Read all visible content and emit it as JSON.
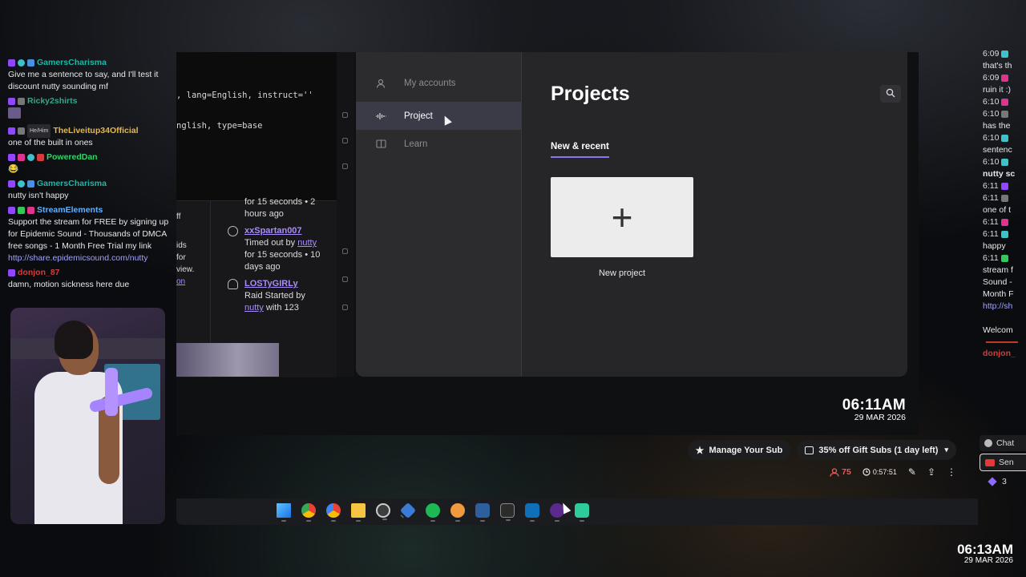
{
  "left_chat": [
    {
      "user": "GamersCharisma",
      "color": "#1fb6a6",
      "badges": [
        "purple",
        "teal",
        "blue"
      ],
      "pronoun": "",
      "text": "Give me a sentence to say, and I'll test it discount nutty sounding mf"
    },
    {
      "user": "Ricky2shirts",
      "color": "#3aa38a",
      "badges": [
        "purple",
        "gray"
      ],
      "pronoun": "",
      "text": "",
      "emote": true
    },
    {
      "user": "TheLiveitup34Official",
      "color": "#e6b84a",
      "badges": [
        "purple",
        "gray"
      ],
      "pronoun": "He/Him",
      "text": "one of the built in ones"
    },
    {
      "user": "PoweredDan",
      "color": "#2fd66b",
      "badges": [
        "purple",
        "pink",
        "teal",
        "red"
      ],
      "pronoun": "",
      "text": "😂"
    },
    {
      "user": "GamersCharisma",
      "color": "#1fb6a6",
      "badges": [
        "purple",
        "teal",
        "blue"
      ],
      "pronoun": "",
      "text": "nutty isn't happy"
    },
    {
      "user": "StreamElements",
      "color": "#5fb2ff",
      "badges": [
        "purple",
        "green",
        "pink"
      ],
      "pronoun": "",
      "text": "Support the stream for FREE by signing up for Epidemic Sound - Thousands of DMCA free songs - 1 Month Free Trial my link",
      "link": "http://share.epidemicsound.com/nutty"
    },
    {
      "user": "donjon_87",
      "color": "#d63b3b",
      "badges": [
        "purple"
      ],
      "pronoun": "",
      "text": "damn, motion sickness here due"
    }
  ],
  "terminal": {
    "line1": ", lang=English, instruct=''",
    "line2": "nglish, type=base"
  },
  "strip_left": [
    "ff",
    "",
    "ids",
    "for",
    "view.",
    "on"
  ],
  "mod_log": {
    "top_text": "for 15 seconds • 2 hours ago",
    "entries": [
      {
        "user": "xxSpartan007",
        "line1_prefix": "Timed out by ",
        "line1_link": "nutty",
        "rest": "for 15 seconds • 10 days ago"
      },
      {
        "user": "LOSTyGIRLy",
        "line1_prefix": "Raid Started by",
        "line1_link": "nutty",
        "rest": "with 123"
      }
    ]
  },
  "app": {
    "nav": [
      {
        "label": "My accounts",
        "icon": "person-icon",
        "active": false
      },
      {
        "label": "Project",
        "icon": "waveform-icon",
        "active": true
      },
      {
        "label": "Learn",
        "icon": "book-icon",
        "active": false
      }
    ],
    "title": "Projects",
    "tab": "New & recent",
    "new_card_symbol": "+",
    "new_card_label": "New project"
  },
  "inner_clock": {
    "time": "06:11AM",
    "date": "29 MAR 2026"
  },
  "right_chat": [
    {
      "time": "6:09",
      "badge": "teal",
      "text": ""
    },
    {
      "time": "",
      "badge": "",
      "text": "that's th"
    },
    {
      "time": "6:09",
      "badge": "pink",
      "text": ""
    },
    {
      "time": "",
      "badge": "",
      "text": "ruin it :)"
    },
    {
      "time": "6:10",
      "badge": "pink",
      "text": ""
    },
    {
      "time": "6:10",
      "badge": "gray",
      "text": ""
    },
    {
      "time": "",
      "badge": "",
      "text": "has the"
    },
    {
      "time": "6:10",
      "badge": "teal",
      "text": ""
    },
    {
      "time": "",
      "badge": "",
      "text": "sentenc"
    },
    {
      "time": "6:10",
      "badge": "teal",
      "text": ""
    },
    {
      "time": "",
      "badge": "",
      "text": "nutty sc",
      "bold": true
    },
    {
      "time": "6:11",
      "badge": "purple",
      "text": ""
    },
    {
      "time": "6:11",
      "badge": "gray",
      "text": ""
    },
    {
      "time": "",
      "badge": "",
      "text": "one of t"
    },
    {
      "time": "6:11",
      "badge": "pink",
      "text": ""
    },
    {
      "time": "6:11",
      "badge": "teal",
      "text": ""
    },
    {
      "time": "",
      "badge": "",
      "text": "happy"
    },
    {
      "time": "6:11",
      "badge": "green",
      "text": ""
    },
    {
      "time": "",
      "badge": "",
      "text": "stream f"
    },
    {
      "time": "",
      "badge": "",
      "text": "Sound -"
    },
    {
      "time": "",
      "badge": "",
      "text": "Month F"
    },
    {
      "time": "",
      "badge": "",
      "text": "http://sh",
      "link": true
    },
    {
      "time": "",
      "badge": "",
      "text": ""
    },
    {
      "time": "",
      "badge": "",
      "text": "Welcom"
    }
  ],
  "right_chat_last_user": "donjon_",
  "right_buttons": {
    "chat": "Chat",
    "send": "Sen",
    "points": "3"
  },
  "controls": {
    "manage_sub": "Manage Your Sub",
    "gift_subs": "35% off Gift Subs (1 day left)",
    "viewers": "75",
    "uptime": "0:57:51"
  },
  "taskbar_icons": [
    "windows-start-icon",
    "chrome-icon",
    "chrome-alt-icon",
    "file-explorer-icon",
    "obs-icon",
    "app-blue-icon",
    "spotify-icon",
    "davinci-resolve-icon",
    "audio-app-icon",
    "terminal-icon",
    "store-icon",
    "purple-app-icon",
    "green-app-icon"
  ],
  "outer_clock": {
    "time": "06:13AM",
    "date": "29 MAR 2026"
  },
  "colors": {
    "accent": "#8b75f0",
    "viewer_red": "#f05a5a",
    "link": "#a98bfa"
  }
}
